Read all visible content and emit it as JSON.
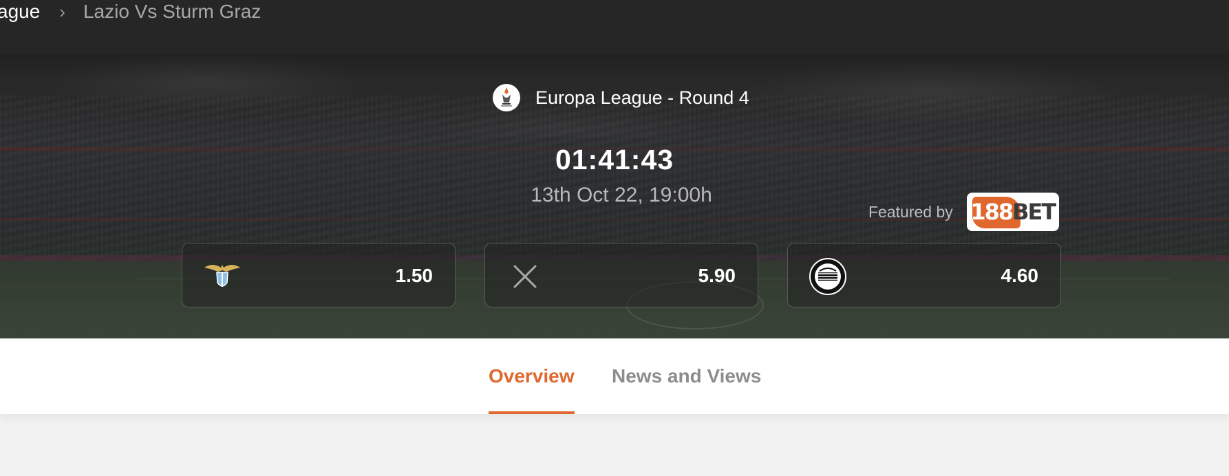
{
  "breadcrumb": {
    "parent": "ague",
    "separator": "›",
    "current": "Lazio Vs Sturm Graz"
  },
  "match": {
    "competition": "Europa League - Round 4",
    "competition_icon": "europa-league-logo-icon",
    "countdown": "01:41:43",
    "kickoff": "13th Oct 22, 19:00h"
  },
  "sponsor": {
    "label": "Featured by",
    "name_part1": "188",
    "name_part2": "BET",
    "brand_color": "#e0682e"
  },
  "odds": [
    {
      "outcome_icon": "lazio-crest-icon",
      "value": "1.50"
    },
    {
      "outcome_icon": "draw-x-icon",
      "value": "5.90"
    },
    {
      "outcome_icon": "sturm-graz-crest-icon",
      "value": "4.60"
    }
  ],
  "tabs": [
    {
      "label": "Overview",
      "active": true
    },
    {
      "label": "News and Views",
      "active": false
    }
  ],
  "colors": {
    "accent": "#e0682e",
    "header_bg": "#262626",
    "tab_inactive": "#8d8d8d"
  }
}
